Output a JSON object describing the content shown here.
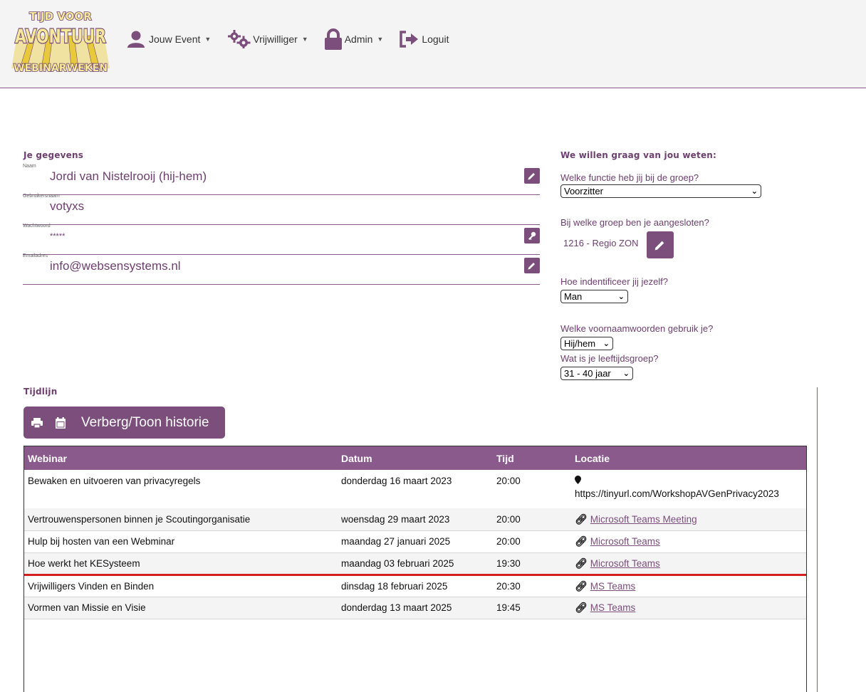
{
  "header": {
    "logo": {
      "line1": "TIJD VOOR",
      "line2": "AVONTUUR",
      "line3": "WEBINARWEKEN"
    },
    "nav": [
      {
        "label": "Jouw Event",
        "icon": "user-icon",
        "dropdown": true
      },
      {
        "label": "Vrijwilliger",
        "icon": "gears-icon",
        "dropdown": true
      },
      {
        "label": "Admin",
        "icon": "lock-icon",
        "dropdown": true
      },
      {
        "label": "Loguit",
        "icon": "logout-icon",
        "dropdown": false
      }
    ]
  },
  "profile": {
    "title": "Je gegevens",
    "fields": [
      {
        "label": "Naam",
        "value": "Jordi van Nistelrooij (hij-hem)",
        "action": "edit"
      },
      {
        "label": "Gebruikersnaam",
        "value": "votyxs",
        "action": ""
      },
      {
        "label": "Wachtwoord",
        "value": "*****",
        "action": "key"
      },
      {
        "label": "Emailadres",
        "value": "info@websensystems.nl",
        "action": "edit"
      }
    ]
  },
  "survey": {
    "title": "We willen graag van jou weten:",
    "q_function": "Welke functie heb jij bij de groep?",
    "function_value": "Voorzitter",
    "q_group": "Bij welke groep ben je aangesloten?",
    "group_value": "1216 - Regio ZON",
    "q_identify": "Hoe indentificeer jij jezelf?",
    "identify_value": "Man",
    "q_pronouns": "Welke voornaamwoorden gebruik je?",
    "pronouns_value": "Hij/hem",
    "q_age": "Wat is je leeftijdsgroep?",
    "age_value": "31 - 40 jaar"
  },
  "timeline": {
    "title": "Tijdlijn",
    "toggle_label": "Verberg/Toon historie",
    "columns": [
      "Webinar",
      "Datum",
      "Tijd",
      "Locatie"
    ],
    "rows": [
      {
        "webinar": "Bewaken en uitvoeren van privacyregels",
        "datum": "donderdag 16 maart 2023",
        "tijd": "20:00",
        "locatie": "https://tinyurl.com/WorkshopAVGenPrivacy2023",
        "type": "text"
      },
      {
        "webinar": "Vertrouwenspersonen binnen je Scoutingorganisatie",
        "datum": "woensdag 29 maart 2023",
        "tijd": "20:00",
        "locatie": "Microsoft Teams Meeting",
        "type": "link"
      },
      {
        "webinar": "Hulp bij hosten van een Webminar",
        "datum": "maandag 27 januari 2025",
        "tijd": "20:00",
        "locatie": "Microsoft Teams",
        "type": "link"
      },
      {
        "webinar": "Hoe werkt het KESysteem",
        "datum": "maandag 03 februari 2025",
        "tijd": "19:30",
        "locatie": "Microsoft Teams",
        "type": "link"
      },
      {
        "webinar": "Vrijwilligers Vinden en Binden",
        "datum": "dinsdag 18 februari 2025",
        "tijd": "20:30",
        "locatie": "MS Teams",
        "type": "link"
      },
      {
        "webinar": "Vormen van Missie en Visie",
        "datum": "donderdag 13 maart 2025",
        "tijd": "19:45",
        "locatie": "MS Teams",
        "type": "link"
      }
    ]
  }
}
